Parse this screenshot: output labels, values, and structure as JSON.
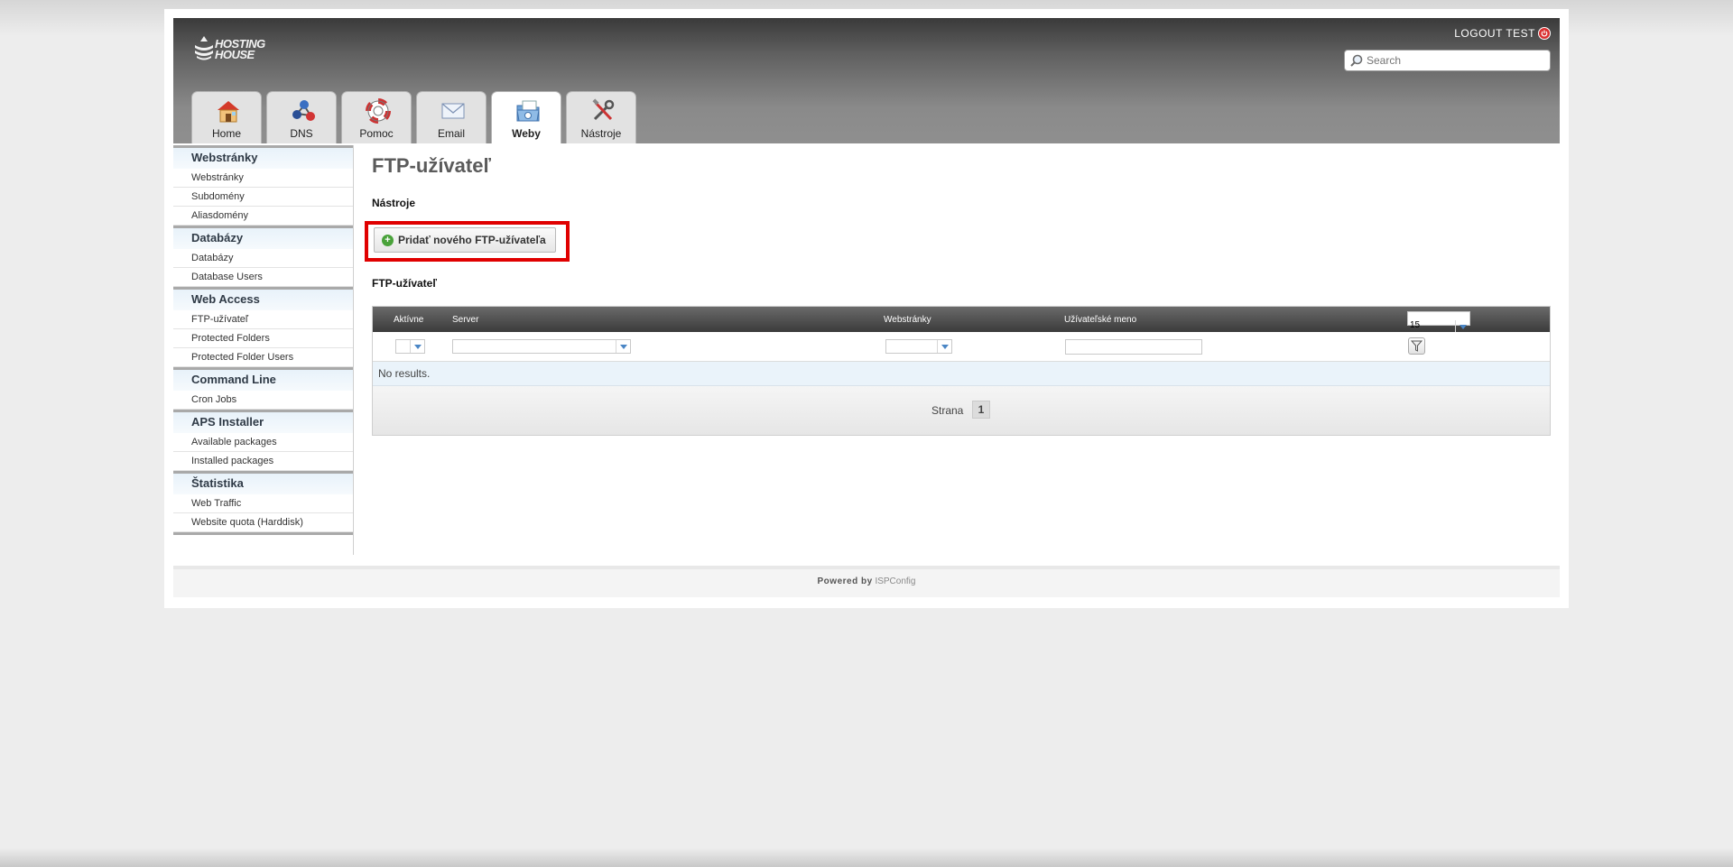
{
  "brand": {
    "logo_line1": "HOSTING",
    "logo_line2": "HOUSE"
  },
  "header": {
    "logout_label": "LOGOUT TEST",
    "search_placeholder": "Search"
  },
  "tabs": [
    {
      "label": "Home",
      "icon": "home-icon"
    },
    {
      "label": "DNS",
      "icon": "dns-icon"
    },
    {
      "label": "Pomoc",
      "icon": "help-lifebuoy-icon"
    },
    {
      "label": "Email",
      "icon": "email-icon"
    },
    {
      "label": "Weby",
      "icon": "web-folder-icon",
      "active": true
    },
    {
      "label": "Nástroje",
      "icon": "tools-icon"
    }
  ],
  "sidebar": {
    "sections": [
      {
        "title": "Webstránky",
        "items": [
          "Webstránky",
          "Subdomény",
          "Aliasdomény"
        ]
      },
      {
        "title": "Databázy",
        "items": [
          "Databázy",
          "Database Users"
        ]
      },
      {
        "title": "Web Access",
        "items": [
          "FTP-užívateľ",
          "Protected Folders",
          "Protected Folder Users"
        ]
      },
      {
        "title": "Command Line",
        "items": [
          "Cron Jobs"
        ]
      },
      {
        "title": "APS Installer",
        "items": [
          "Available packages",
          "Installed packages"
        ]
      },
      {
        "title": "Štatistika",
        "items": [
          "Web Traffic",
          "Website quota (Harddisk)"
        ]
      }
    ]
  },
  "main": {
    "title": "FTP-užívateľ",
    "tools_label": "Nástroje",
    "add_button_label": "Pridať nového FTP-užívateľa",
    "list_label": "FTP-užívateľ",
    "table": {
      "columns": [
        "Aktívne",
        "Server",
        "Webstránky",
        "Užívateľské meno"
      ],
      "page_size": "15",
      "empty_text": "No results.",
      "pager_label": "Strana",
      "current_page": "1"
    }
  },
  "footer": {
    "powered_by": "Powered by",
    "link": "ISPConfig"
  },
  "colors": {
    "highlight": "#e00000",
    "header_dark": "#3a3a3a",
    "sidebar_header": "#e8f2fa"
  }
}
